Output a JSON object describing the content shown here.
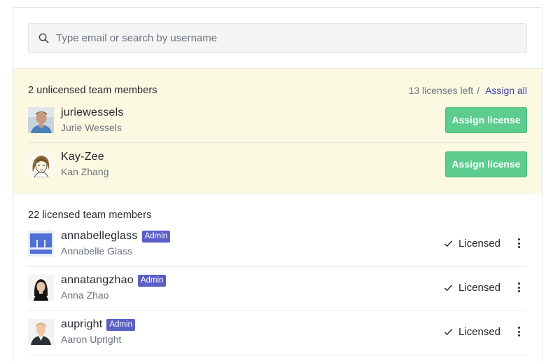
{
  "search": {
    "placeholder": "Type email or search by username"
  },
  "unlicensed": {
    "title": "2 unlicensed team members",
    "licenses_left": "13 licenses left",
    "separator": "/",
    "assign_all": "Assign all",
    "members": [
      {
        "username": "juriewessels",
        "fullname": "Jurie Wessels",
        "button": "Assign license"
      },
      {
        "username": "Kay-Zee",
        "fullname": "Kan Zhang",
        "button": "Assign license"
      }
    ]
  },
  "licensed": {
    "title": "22 licensed team members",
    "members": [
      {
        "username": "annabelleglass",
        "fullname": "Annabelle Glass",
        "badge": "Admin",
        "status": "Licensed"
      },
      {
        "username": "annatangzhao",
        "fullname": "Anna Zhao",
        "badge": "Admin",
        "status": "Licensed"
      },
      {
        "username": "aupright",
        "fullname": "Aaron Upright",
        "badge": "Admin",
        "status": "Licensed"
      }
    ]
  },
  "colors": {
    "unlicensed_bg": "#fcf9e3",
    "assign_button": "#5ccc8f",
    "badge": "#5a5fc4",
    "link": "#4040a8"
  }
}
